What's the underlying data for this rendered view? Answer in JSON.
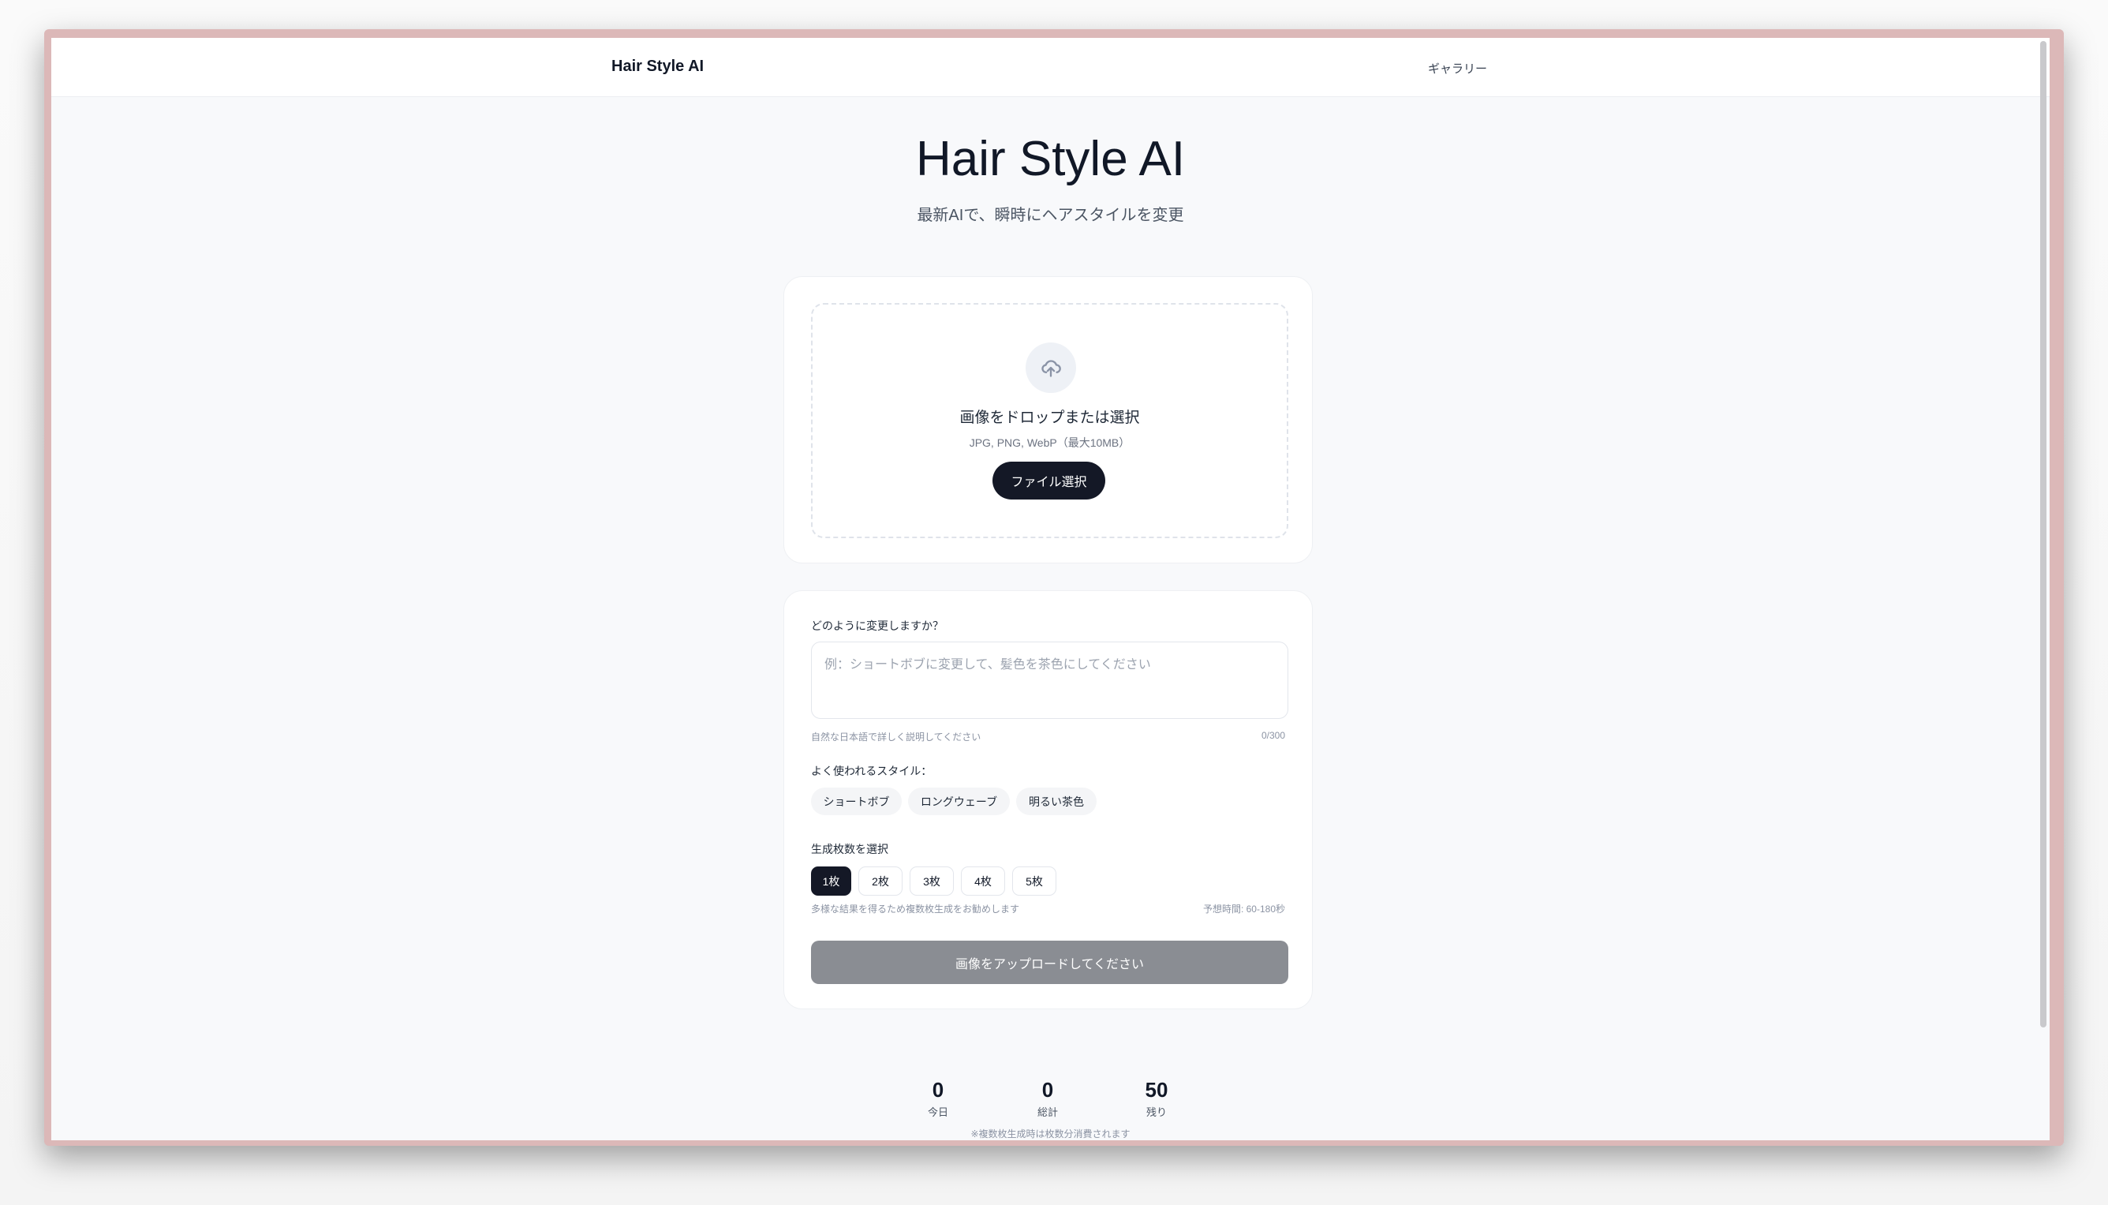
{
  "header": {
    "logo": "Hair Style AI",
    "nav_gallery": "ギャラリー"
  },
  "hero": {
    "title": "Hair Style AI",
    "subtitle": "最新AIで、瞬時にヘアスタイルを変更"
  },
  "upload": {
    "icon": "cloud-upload-icon",
    "title": "画像をドロップまたは選択",
    "formats": "JPG, PNG, WebP（最大10MB）",
    "button": "ファイル選択"
  },
  "form": {
    "prompt_label": "どのように変更しますか？",
    "prompt_value": "",
    "prompt_placeholder": "例：ショートボブに変更して、髪色を茶色にしてください",
    "prompt_help": "自然な日本語で詳しく説明してください",
    "char_count": "0/300",
    "styles_label": "よく使われるスタイル：",
    "styles": [
      "ショートボブ",
      "ロングウェーブ",
      "明るい茶色"
    ],
    "count_label": "生成枚数を選択",
    "counts": [
      "1枚",
      "2枚",
      "3枚",
      "4枚",
      "5枚"
    ],
    "selected_count": "1枚",
    "count_hint": "多様な結果を得るため複数枚生成をお勧めします",
    "estimate": "予想時間: 60-180秒",
    "submit": "画像をアップロードしてください"
  },
  "stats": [
    {
      "value": "0",
      "label": "今日"
    },
    {
      "value": "0",
      "label": "総計"
    },
    {
      "value": "50",
      "label": "残り"
    }
  ],
  "stats_note": "※複数枚生成時は枚数分消費されます",
  "colors": {
    "primary": "#141826",
    "disabled": "#8a8d93",
    "background": "#f8f9fb"
  }
}
